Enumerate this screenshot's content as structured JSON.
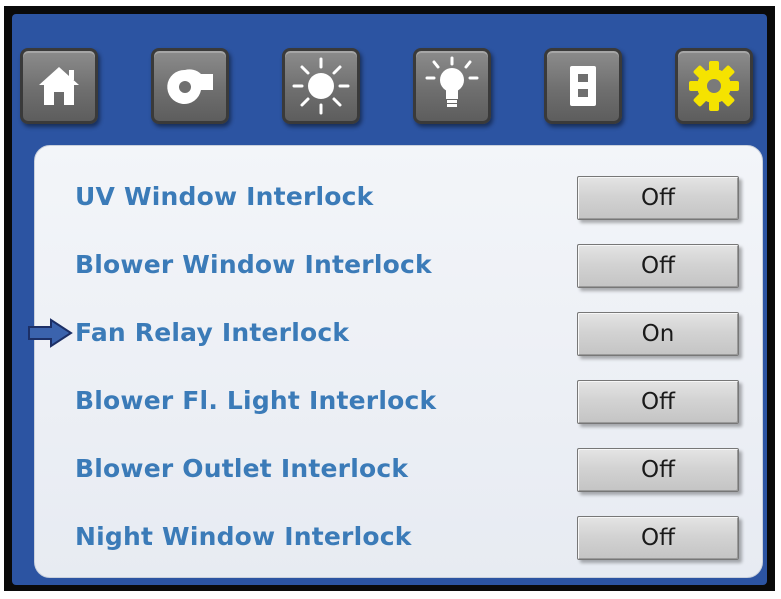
{
  "tabs": [
    {
      "icon": "home-icon"
    },
    {
      "icon": "blower-icon"
    },
    {
      "icon": "uv-lamp-icon"
    },
    {
      "icon": "light-bulb-icon"
    },
    {
      "icon": "outlet-icon"
    },
    {
      "icon": "settings-gear-icon",
      "active": true,
      "accent": "#f5e300"
    }
  ],
  "colors": {
    "frame": "#2c54a2",
    "label": "#3b7bb8",
    "gear_active": "#f5e300",
    "indicator_arrow": "#3b63ad"
  },
  "interlocks": [
    {
      "label": "UV Window Interlock",
      "state": "Off"
    },
    {
      "label": "Blower Window Interlock",
      "state": "Off"
    },
    {
      "label": "Fan Relay Interlock",
      "state": "On",
      "selected": true
    },
    {
      "label": "Blower Fl. Light Interlock",
      "state": "Off"
    },
    {
      "label": "Blower Outlet Interlock",
      "state": "Off"
    },
    {
      "label": "Night Window Interlock",
      "state": "Off"
    }
  ]
}
